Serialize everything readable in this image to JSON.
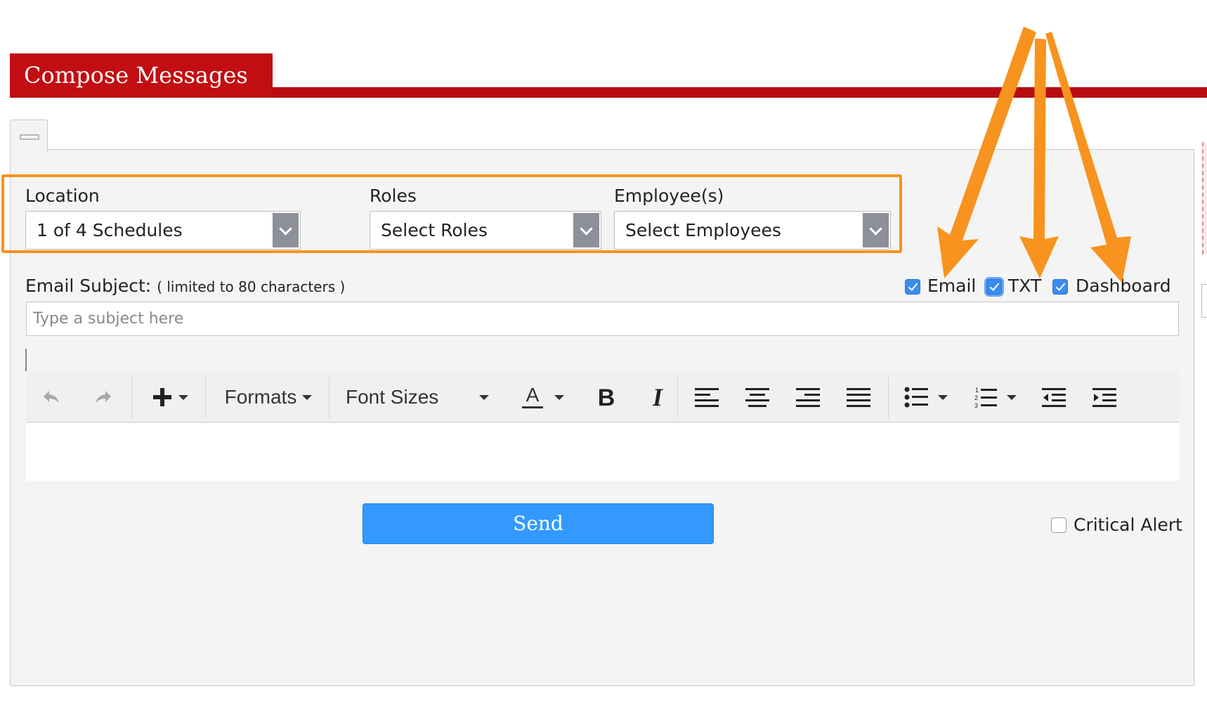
{
  "header": {
    "title": "Compose Messages",
    "accent_color": "#c20e12"
  },
  "filters": {
    "location": {
      "label": "Location",
      "value": "1 of 4 Schedules"
    },
    "roles": {
      "label": "Roles",
      "value": "Select Roles"
    },
    "employees": {
      "label": "Employee(s)",
      "value": "Select Employees"
    }
  },
  "channels": [
    {
      "label": "Email",
      "checked": true
    },
    {
      "label": "TXT",
      "checked": true
    },
    {
      "label": "Dashboard",
      "checked": true
    }
  ],
  "subject": {
    "label": "Email Subject:",
    "note": "( limited to 80 characters )",
    "placeholder": "Type a subject here",
    "value": ""
  },
  "toolbar": {
    "formats_label": "Formats",
    "font_sizes_label": "Font Sizes",
    "icons": [
      "undo-icon",
      "redo-icon",
      "insert-icon",
      "text-color-icon",
      "bold-icon",
      "italic-icon",
      "align-left-icon",
      "align-center-icon",
      "align-right-icon",
      "justify-icon",
      "bullet-list-icon",
      "numbered-list-icon",
      "outdent-icon",
      "indent-icon"
    ]
  },
  "send": {
    "label": "Send",
    "color": "#3399ff"
  },
  "critical_alert": {
    "label": "Critical Alert",
    "checked": false
  },
  "annotation_color": "#f7931e"
}
